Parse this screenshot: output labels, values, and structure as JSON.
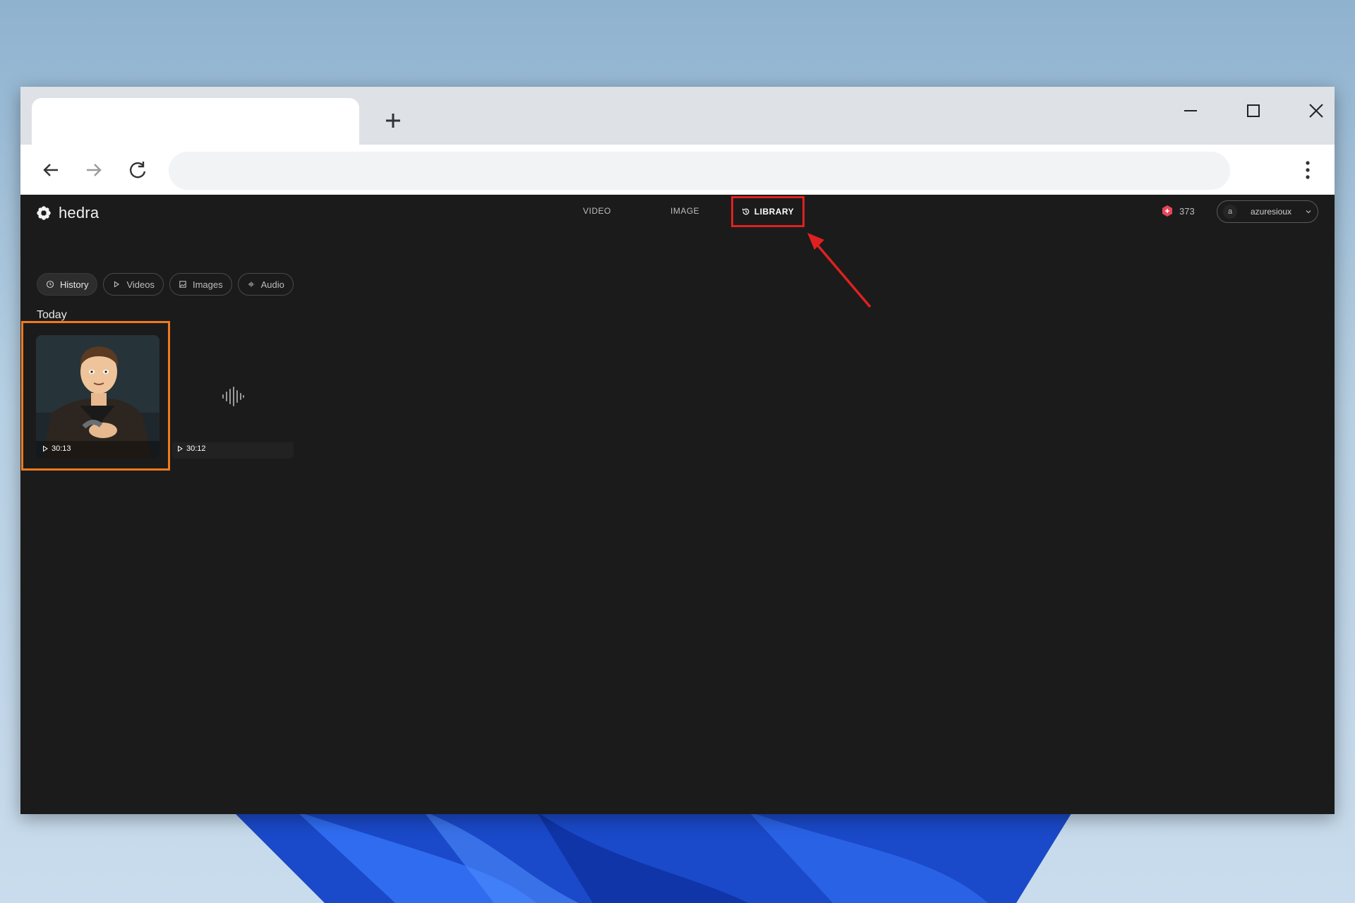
{
  "browser": {
    "new_tab_icon": "plus-icon",
    "window_controls": [
      "minimize-icon",
      "maximize-icon",
      "close-icon"
    ]
  },
  "app": {
    "brand": {
      "name": "hedra",
      "logo_icon": "flower-logo-icon"
    },
    "nav": {
      "video": "VIDEO",
      "image": "IMAGE",
      "library": "LIBRARY"
    },
    "credits": {
      "value": "373",
      "icon": "hexagon-credit-icon",
      "color": "#e8455a"
    },
    "account": {
      "avatar_letter": "a",
      "username": "azuresioux"
    },
    "filters": [
      {
        "label": "History",
        "icon": "clock-icon",
        "active": true
      },
      {
        "label": "Videos",
        "icon": "play-icon",
        "active": false
      },
      {
        "label": "Images",
        "icon": "image-icon",
        "active": false
      },
      {
        "label": "Audio",
        "icon": "audio-icon",
        "active": false
      }
    ],
    "section": "Today",
    "items": [
      {
        "type": "video",
        "duration": "30:13"
      },
      {
        "type": "audio",
        "duration": "30:12"
      }
    ]
  },
  "colors": {
    "accent_red": "#e02020",
    "highlight_orange": "#f07a1d",
    "background": "#1b1b1b"
  }
}
